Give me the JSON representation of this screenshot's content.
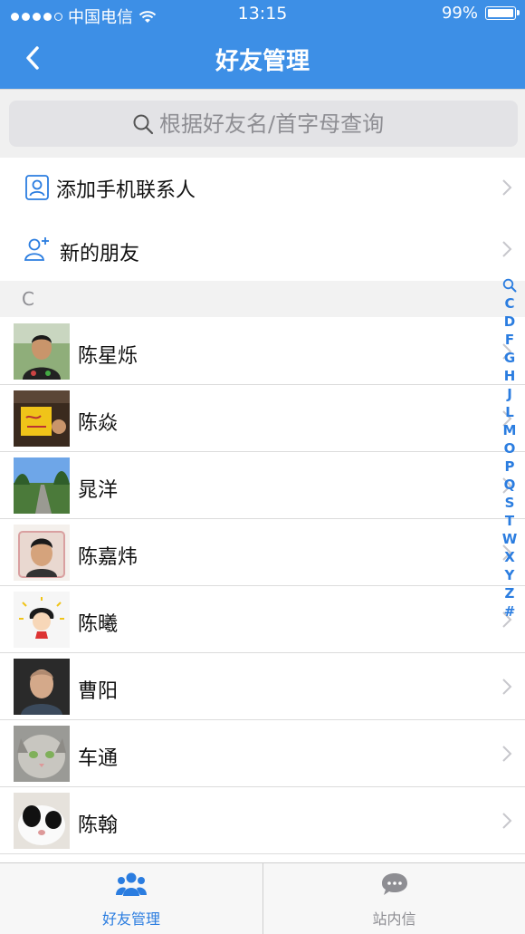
{
  "status_bar": {
    "carrier": "中国电信",
    "time": "13:15",
    "battery": "99%"
  },
  "nav": {
    "title": "好友管理",
    "back_icon": "chevron-left-icon"
  },
  "search": {
    "placeholder": "根据好友名/首字母查询"
  },
  "menu": [
    {
      "label": "添加手机联系人",
      "icon": "contacts-icon"
    },
    {
      "label": "新的朋友",
      "icon": "add-friend-icon"
    }
  ],
  "section": {
    "letter": "C"
  },
  "contacts": [
    {
      "name": "陈星烁"
    },
    {
      "name": "陈焱"
    },
    {
      "name": "晁洋"
    },
    {
      "name": "陈嘉炜"
    },
    {
      "name": "陈曦"
    },
    {
      "name": "曹阳"
    },
    {
      "name": "车通"
    },
    {
      "name": "陈翰"
    }
  ],
  "index_letters": [
    "C",
    "D",
    "F",
    "G",
    "H",
    "J",
    "L",
    "M",
    "O",
    "P",
    "Q",
    "S",
    "T",
    "W",
    "X",
    "Y",
    "Z",
    "#"
  ],
  "tabs": [
    {
      "label": "好友管理",
      "icon": "friends-icon",
      "active": true
    },
    {
      "label": "站内信",
      "icon": "message-icon",
      "active": false
    }
  ],
  "colors": {
    "primary": "#3d8fe6",
    "accent": "#2b7de0"
  }
}
